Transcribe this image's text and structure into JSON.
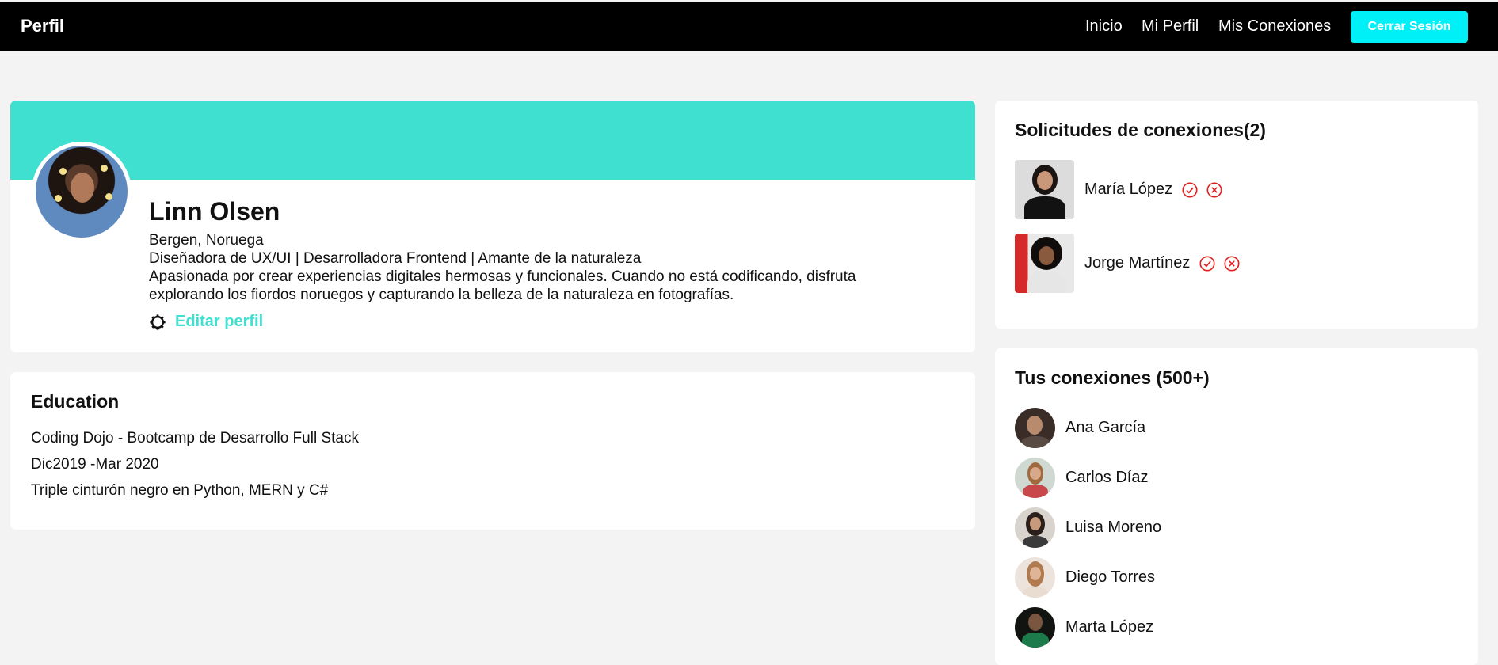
{
  "navbar": {
    "brand": "Perfil",
    "links": [
      "Inicio",
      "Mi Perfil",
      "Mis Conexiones"
    ],
    "logout_label": "Cerrar Sesión"
  },
  "profile": {
    "name": "Linn Olsen",
    "location": "Bergen, Noruega",
    "headline": "Diseñadora de UX/UI | Desarrolladora Frontend | Amante de la naturaleza",
    "bio_line1": "Apasionada por crear experiencias digitales hermosas y funcionales. Cuando no está codificando, disfruta",
    "bio_line2": "explorando los fiordos noruegos y capturando la belleza de la naturaleza en fotografías.",
    "edit_label": "Editar perfil",
    "edit_icon": "gear-icon"
  },
  "education": {
    "title": "Education",
    "school": "Coding Dojo - Bootcamp de Desarrollo Full Stack",
    "dates": "Dic2019 -Mar 2020",
    "detail": "Triple cinturón negro en Python, MERN y C#"
  },
  "requests": {
    "title": "Solicitudes de conexiones(2)",
    "items": [
      {
        "name": "María López",
        "accept_icon": "check-circle-icon",
        "reject_icon": "x-circle-icon"
      },
      {
        "name": "Jorge Martínez",
        "accept_icon": "check-circle-icon",
        "reject_icon": "x-circle-icon"
      }
    ]
  },
  "connections": {
    "title": "Tus conexiones (500+)",
    "items": [
      {
        "name": "Ana García"
      },
      {
        "name": "Carlos Díaz"
      },
      {
        "name": "Luisa Moreno"
      },
      {
        "name": "Diego Torres"
      },
      {
        "name": "Marta López"
      }
    ]
  },
  "colors": {
    "accent": "#40e0d0",
    "logout_button": "#00f0f8",
    "navbar": "#000000",
    "background": "#f3f3f3",
    "action_red": "#e02020"
  }
}
